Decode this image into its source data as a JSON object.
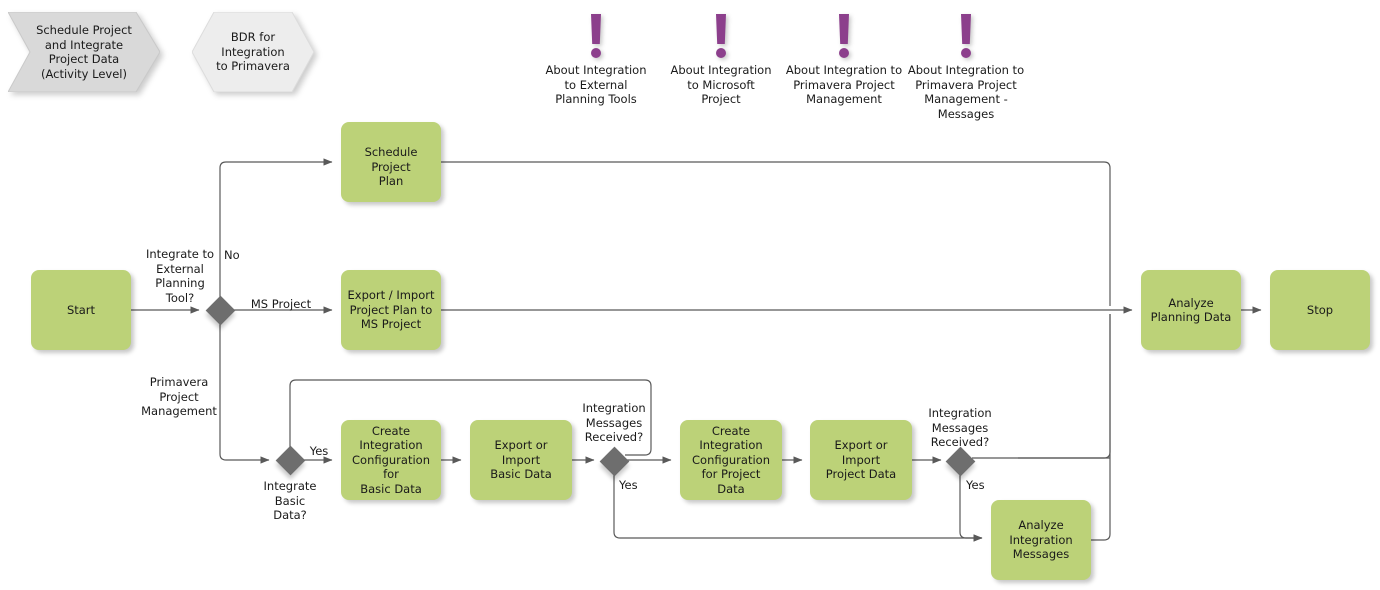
{
  "diagram": {
    "title": "Schedule Project and Integrate Project Data (Activity Level)",
    "colors": {
      "task_fill": "#bcd278",
      "gateway_fill": "#6e6e6e",
      "annotation": "#8c3f8c",
      "pool_header_fill": "#d9d9d9",
      "lane_header_fill": "#ededed",
      "connector": "#595959"
    },
    "headers": [
      {
        "id": "pool-header",
        "label": "Schedule Project\nand Integrate\nProject Data\n(Activity Level)",
        "shape": "chevron"
      },
      {
        "id": "lane-header",
        "label": "BDR for\nIntegration\nto Primavera",
        "shape": "hexagon"
      }
    ],
    "annotations": [
      {
        "id": "note-external-planning",
        "icon": "exclamation-icon",
        "label": "About Integration\nto External\nPlanning Tools"
      },
      {
        "id": "note-microsoft-project",
        "icon": "exclamation-icon",
        "label": "About Integration\nto Microsoft\nProject"
      },
      {
        "id": "note-primavera",
        "icon": "exclamation-icon",
        "label": "About Integration to\nPrimavera Project\nManagement"
      },
      {
        "id": "note-primavera-messages",
        "icon": "exclamation-icon",
        "label": "About Integration to\nPrimavera Project\nManagement -\nMessages"
      }
    ],
    "tasks": [
      {
        "id": "start",
        "label": "Start"
      },
      {
        "id": "schedule-project-plan",
        "label": "Schedule Project\nPlan"
      },
      {
        "id": "export-import-ms",
        "label": "Export / Import\nProject Plan to\nMS Project"
      },
      {
        "id": "create-config-basic",
        "label": "Create\nIntegration\nConfiguration for\nBasic Data"
      },
      {
        "id": "export-import-basic",
        "label": "Export or Import\nBasic Data"
      },
      {
        "id": "create-config-project",
        "label": "Create\nIntegration\nConfiguration\nfor Project\nData"
      },
      {
        "id": "export-import-project",
        "label": "Export or\nImport\nProject Data"
      },
      {
        "id": "analyze-integration",
        "label": "Analyze\nIntegration\nMessages"
      },
      {
        "id": "analyze-planning",
        "label": "Analyze\nPlanning Data"
      },
      {
        "id": "stop",
        "label": "Stop"
      }
    ],
    "gateways": [
      {
        "id": "gw-integrate-external",
        "question": "Integrate to\nExternal\nPlanning\nTool?"
      },
      {
        "id": "gw-integrate-basic",
        "question": "Integrate\nBasic\nData?"
      },
      {
        "id": "gw-messages-basic",
        "question": "Integration\nMessages\nReceived?"
      },
      {
        "id": "gw-messages-project",
        "question": "Integration\nMessages\nReceived?"
      }
    ],
    "edge_labels": [
      {
        "id": "edge-no",
        "label": "No"
      },
      {
        "id": "edge-ms-project",
        "label": "MS Project"
      },
      {
        "id": "edge-primavera",
        "label": "Primavera\nProject\nManagement"
      },
      {
        "id": "edge-yes-basic",
        "label": "Yes"
      },
      {
        "id": "edge-yes-messages-basic",
        "label": "Yes"
      },
      {
        "id": "edge-yes-messages-project",
        "label": "Yes"
      }
    ]
  }
}
